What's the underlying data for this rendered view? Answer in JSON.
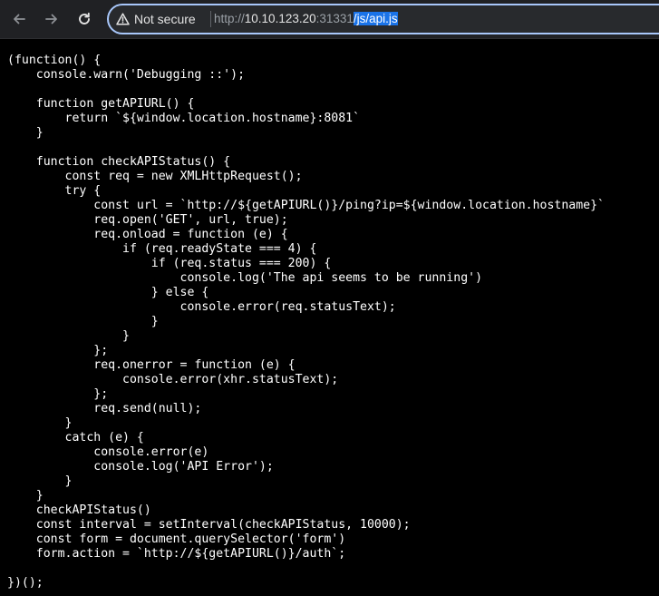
{
  "browser": {
    "nav": {
      "back_icon": "arrow-left-icon",
      "forward_icon": "arrow-right-icon",
      "reload_icon": "reload-icon"
    },
    "security_label": "Not secure",
    "security_icon": "warning-triangle-icon",
    "url": {
      "scheme": "http://",
      "host": "10.10.123.20",
      "port": ":31331",
      "path": "/js/api.js"
    }
  },
  "source_lines": [
    "(function() {",
    "    console.warn('Debugging ::');",
    "",
    "    function getAPIURL() {",
    "        return `${window.location.hostname}:8081`",
    "    }",
    "",
    "    function checkAPIStatus() {",
    "        const req = new XMLHttpRequest();",
    "        try {",
    "            const url = `http://${getAPIURL()}/ping?ip=${window.location.hostname}`",
    "            req.open('GET', url, true);",
    "            req.onload = function (e) {",
    "                if (req.readyState === 4) {",
    "                    if (req.status === 200) {",
    "                        console.log('The api seems to be running')",
    "                    } else {",
    "                        console.error(req.statusText);",
    "                    }",
    "                }",
    "            };",
    "            req.onerror = function (e) {",
    "                console.error(xhr.statusText);",
    "            };",
    "            req.send(null);",
    "        }",
    "        catch (e) {",
    "            console.error(e)",
    "            console.log('API Error');",
    "        }",
    "    }",
    "    checkAPIStatus()",
    "    const interval = setInterval(checkAPIStatus, 10000);",
    "    const form = document.querySelector('form')",
    "    form.action = `http://${getAPIURL()}/auth`;",
    "",
    "})();"
  ]
}
